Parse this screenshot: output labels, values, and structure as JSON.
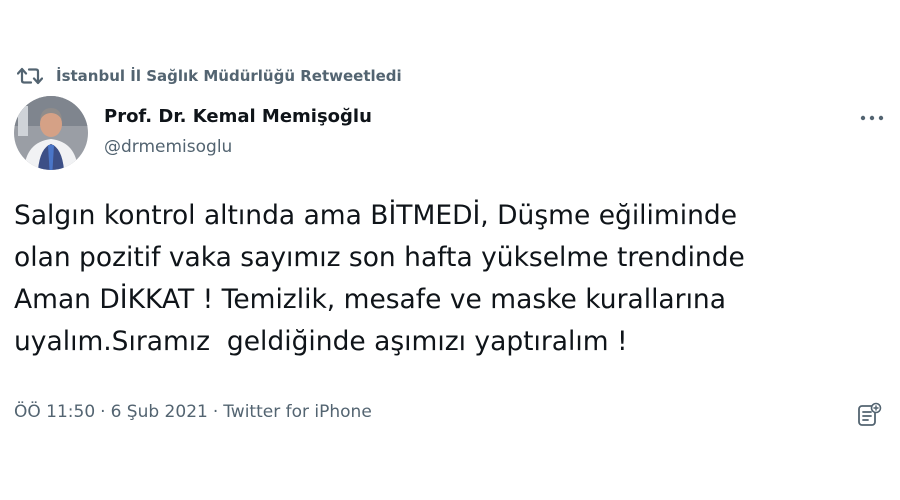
{
  "retweet": {
    "icon": "retweet-icon",
    "text": "İstanbul İl Sağlık Müdürlüğü Retweetledi"
  },
  "author": {
    "avatar_icon": "avatar",
    "name": "Prof. Dr. Kemal Memişoğlu",
    "handle": "@drmemisoglu"
  },
  "more_icon": "more-icon",
  "tweet": {
    "text": "Salgın kontrol altında ama BİTMEDİ, Düşme eğiliminde\nolan pozitif vaka sayımız son hafta yükselme trendinde\nAman DİKKAT ! Temizlik, mesafe ve maske kurallarına\nuyalım.Sıramız  geldiğinde aşımızı yaptıralım !"
  },
  "meta": {
    "time": "ÖÖ 11:50",
    "separator": "·",
    "date": "6 Şub 2021",
    "source": "Twitter for iPhone"
  },
  "analytics_icon": "analytics-icon",
  "colors": {
    "text_primary": "#0f1419",
    "text_secondary": "#536471",
    "background": "#ffffff"
  }
}
